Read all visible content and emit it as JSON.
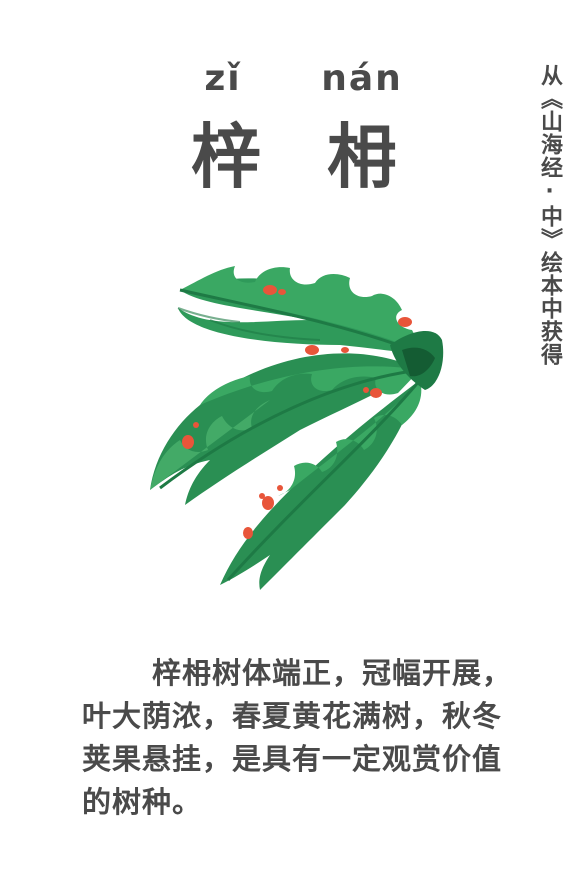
{
  "title": {
    "pinyin": [
      "zǐ",
      "nán"
    ],
    "characters": [
      "梓",
      "枏"
    ]
  },
  "source_note": "从《山海经·中》绘本中获得",
  "illustration": {
    "icon": "leaf-branch-icon",
    "colors": {
      "leaf_dark": "#1e7a45",
      "leaf_mid": "#2f9a5a",
      "leaf_light": "#4fb571",
      "berry": "#e8553a"
    }
  },
  "description": "梓枏树体端正，冠幅开展，叶大荫浓，春夏黄花满树，秋冬荚果悬挂，是具有一定观赏价值的树种。"
}
